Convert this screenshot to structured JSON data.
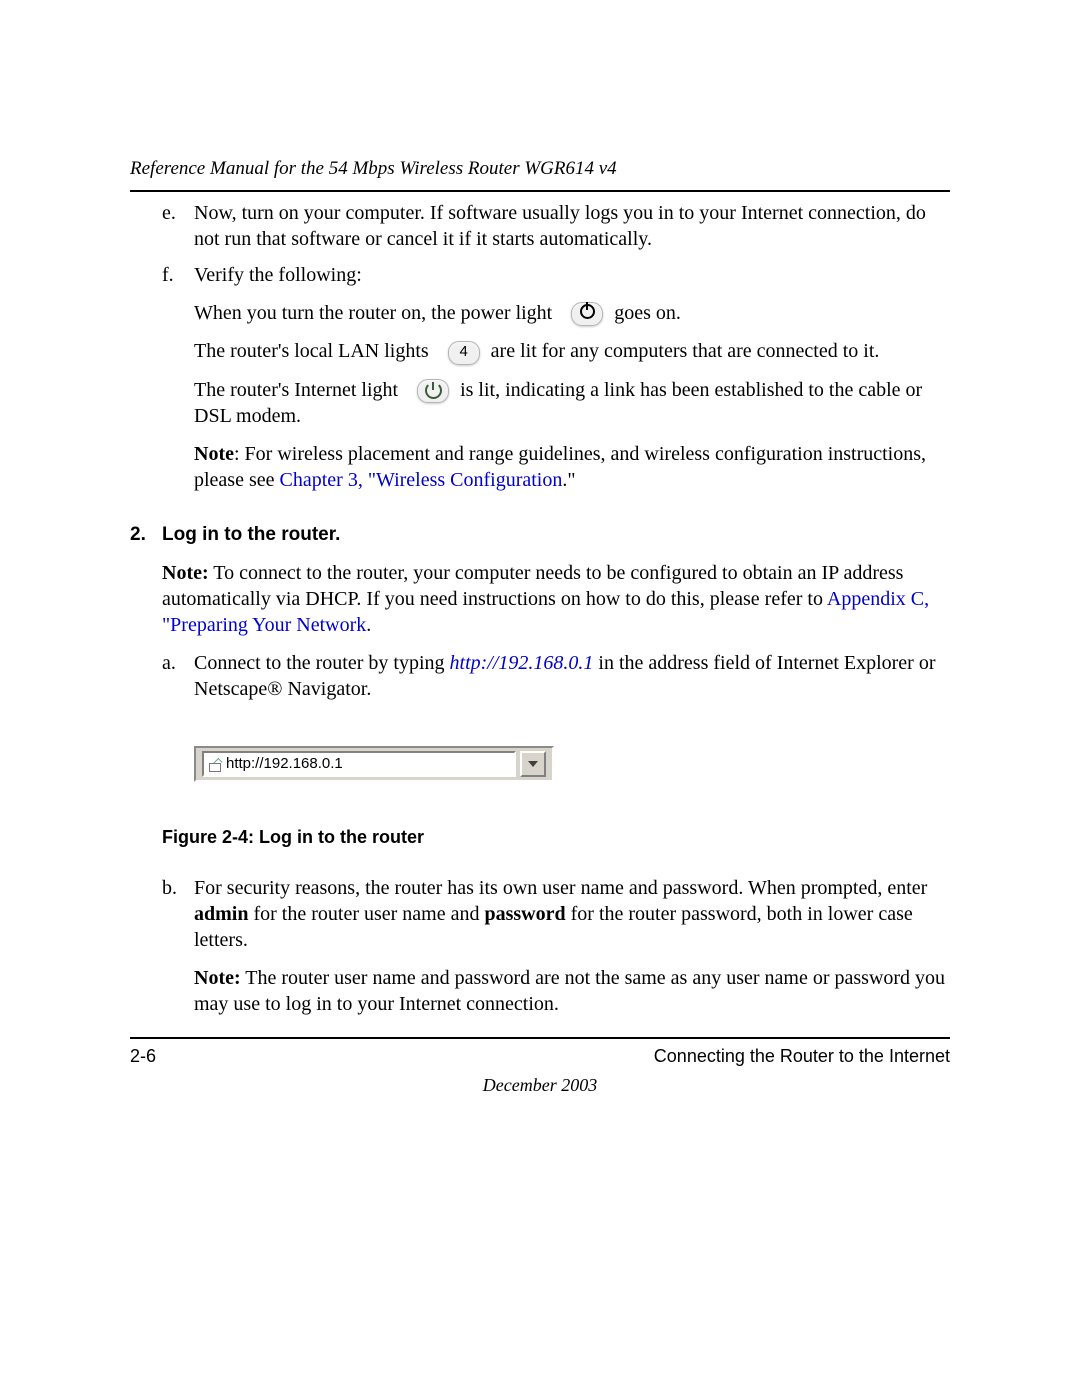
{
  "header": {
    "title": "Reference Manual for the 54 Mbps Wireless Router WGR614 v4"
  },
  "list": {
    "e": {
      "marker": "e.",
      "text": "Now, turn on your computer. If software usually logs you in to your Internet connection, do not run that software or cancel it if it starts automatically."
    },
    "f": {
      "marker": "f.",
      "heading": "Verify the following:",
      "line1_pre": "When you turn the router on, the power light",
      "line1_post": "goes on.",
      "line2_pre": "The router's local LAN lights",
      "lan_icon_label": "4",
      "line2_post": "are lit for any computers that are connected to it.",
      "line3_pre": "The router's Internet light",
      "line3_post": "is lit, indicating a link has been established to the cable or DSL modem.",
      "note_label": "Note",
      "note_text": ": For wireless placement and range guidelines, and wireless configuration instructions, please see ",
      "note_link": "Chapter 3, \"Wireless Configuration",
      "note_tail": ".\""
    }
  },
  "step2": {
    "num": "2.",
    "title": "Log in to the router.",
    "note_label": "Note:",
    "note_text": " To connect to the router, your computer needs to be configured to obtain an IP address automatically via DHCP. If you need instructions on how to do this, please refer to ",
    "note_link": "Appendix C, \"Preparing Your Network",
    "note_tail": ".",
    "a": {
      "marker": "a.",
      "pre": "Connect to the router by typing ",
      "url": "http://192.168.0.1",
      "post": " in the address field of Internet Explorer or Netscape® Navigator."
    },
    "figure": {
      "address": "http://192.168.0.1",
      "caption": "Figure 2-4:  Log in to the router"
    },
    "b": {
      "marker": "b.",
      "pre": "For security reasons, the router has its own user name and password. When prompted, enter ",
      "admin": "admin",
      "mid1": " for the router user name and ",
      "password": "password",
      "mid2": " for the router password, both in lower case letters.",
      "note_label": "Note:",
      "note_text": " The router user name and password are not the same as any user name or password you may use to log in to your Internet connection."
    }
  },
  "footer": {
    "page": "2-6",
    "section": "Connecting the Router to the Internet",
    "date": "December 2003"
  }
}
